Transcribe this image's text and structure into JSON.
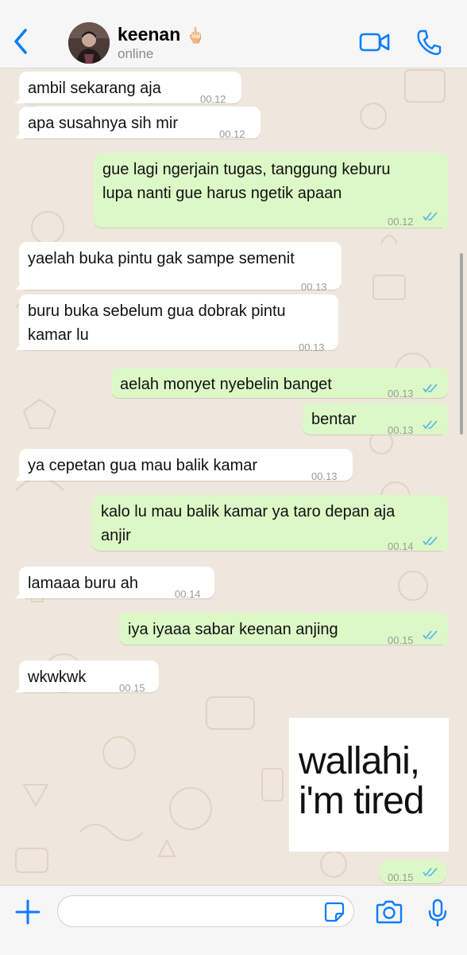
{
  "contact": {
    "name": "keenan",
    "emoji": "🖕🏻",
    "status": "online"
  },
  "icons": {
    "back": "chevron-left-icon",
    "video": "video-camera-icon",
    "call": "phone-icon",
    "plus": "plus-icon",
    "sticker": "sticker-icon",
    "camera": "camera-icon",
    "mic": "microphone-icon"
  },
  "colors": {
    "accent": "#0a7cff",
    "incoming_bubble": "#ffffff",
    "outgoing_bubble": "#dcf8c6",
    "read_ticks": "#4fb6ec",
    "chat_background": "#efe7dd"
  },
  "messages": [
    {
      "dir": "in",
      "lines": [
        "ambil sekarang aja"
      ],
      "time": "00.12"
    },
    {
      "dir": "in",
      "lines": [
        "apa susahnya sih mir"
      ],
      "time": "00.12"
    },
    {
      "dir": "out",
      "lines": [
        "gue lagi ngerjain tugas, tanggung keburu",
        "lupa nanti gue harus ngetik apaan"
      ],
      "time": "00.12",
      "read": true
    },
    {
      "dir": "in",
      "lines": [
        "yaelah buka pintu gak sampe semenit"
      ],
      "time": "00.13"
    },
    {
      "dir": "in",
      "lines": [
        "buru buka sebelum gua dobrak pintu",
        "kamar lu"
      ],
      "time": "00.13"
    },
    {
      "dir": "out",
      "lines": [
        "aelah monyet nyebelin banget"
      ],
      "time": "00.13",
      "read": true
    },
    {
      "dir": "out",
      "lines": [
        "bentar"
      ],
      "time": "00.13",
      "read": true
    },
    {
      "dir": "in",
      "lines": [
        "ya cepetan gua mau balik kamar"
      ],
      "time": "00.13"
    },
    {
      "dir": "out",
      "lines": [
        "kalo lu mau balik kamar ya taro depan aja",
        "anjir"
      ],
      "time": "00.14",
      "read": true
    },
    {
      "dir": "in",
      "lines": [
        "lamaaa buru ah"
      ],
      "time": "00.14"
    },
    {
      "dir": "out",
      "lines": [
        "iya iyaaa sabar keenan anjing"
      ],
      "time": "00.15",
      "read": true
    },
    {
      "dir": "in",
      "lines": [
        "wkwkwk"
      ],
      "time": "00.15"
    }
  ],
  "sticker": {
    "text_line1": "wallahi,",
    "text_line2": "i'm tired",
    "time": "00.15",
    "read": true
  },
  "composer": {
    "value": "",
    "placeholder": ""
  }
}
